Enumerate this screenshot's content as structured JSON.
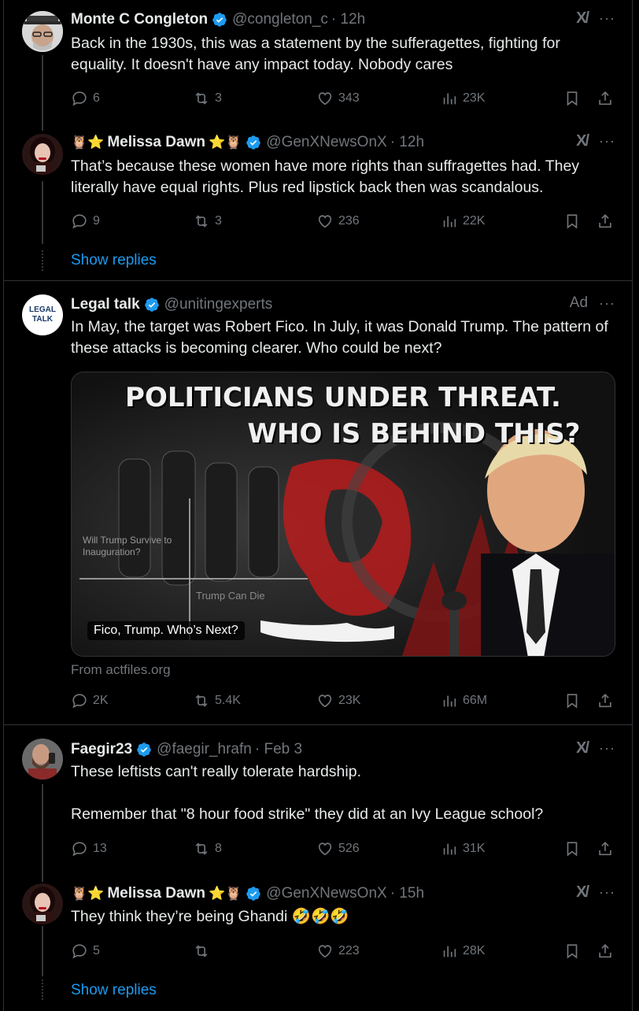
{
  "colors": {
    "background": "#000000",
    "text": "#e7e9ea",
    "muted": "#71767b",
    "link": "#1d9bf0",
    "verified": "#1d9bf0",
    "border": "#2f3336"
  },
  "tweets": [
    {
      "name": "Monte C Congleton",
      "handle": "@congleton_c",
      "time": "· 12h",
      "text": "Back in the 1930s, this was a statement by the sufferagettes, fighting for equality. It doesn't have any impact today. Nobody cares",
      "stats": {
        "replies": "6",
        "reposts": "3",
        "likes": "343",
        "views": "23K"
      }
    },
    {
      "name_prefix": "🦉⭐",
      "name": "Melissa Dawn",
      "name_suffix": "⭐🦉",
      "handle": "@GenXNewsOnX",
      "time": "· 12h",
      "text": "That’s because these women have more rights than suffragettes had. They literally have equal rights. Plus red lipstick back then was scandalous.",
      "stats": {
        "replies": "9",
        "reposts": "3",
        "likes": "236",
        "views": "22K"
      }
    },
    {
      "avatar_text": "LEGAL TALK",
      "name": "Legal talk",
      "handle": "@unitingexperts",
      "ad_label": "Ad",
      "text": "In May, the target was Robert Fico. In July, it was Donald Trump. The pattern of these attacks is becoming clearer. Who could be next?",
      "card": {
        "headline_1": "POLITICIANS UNDER THREAT.",
        "headline_2": "WHO IS BEHIND THIS?",
        "overlay_1": "Will Trump Survive to Inauguration?",
        "overlay_2": "Trump Can Die",
        "caption": "Fico, Trump. Who’s Next?"
      },
      "source": "From actfiles.org",
      "stats": {
        "replies": "2K",
        "reposts": "5.4K",
        "likes": "23K",
        "views": "66M"
      }
    },
    {
      "name": "Faegir23",
      "handle": "@faegir_hrafn",
      "time": "· Feb 3",
      "text_1": "These leftists can't really tolerate hardship.",
      "text_2": "Remember that \"8 hour food strike\" they did at an Ivy League school?",
      "stats": {
        "replies": "13",
        "reposts": "8",
        "likes": "526",
        "views": "31K"
      }
    },
    {
      "name_prefix": "🦉⭐",
      "name": "Melissa Dawn",
      "name_suffix": "⭐🦉",
      "handle": "@GenXNewsOnX",
      "time": "· 15h",
      "text": "They think they’re being Ghandi",
      "text_emoji": "🤣🤣🤣",
      "stats": {
        "replies": "5",
        "reposts": "",
        "likes": "223",
        "views": "28K"
      }
    }
  ],
  "show_replies_label": "Show replies",
  "more_label": "···",
  "grok_label": "X/"
}
